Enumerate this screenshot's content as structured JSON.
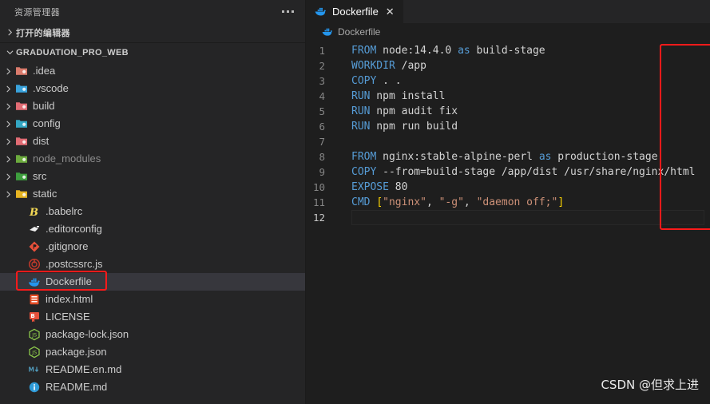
{
  "sidebar": {
    "header_title": "资源管理器",
    "more_actions": "more-actions",
    "open_editors_label": "打开的编辑器",
    "project_label": "GRADUATION_PRO_WEB",
    "items": [
      {
        "label": ".idea",
        "type": "folder",
        "icon": "folder-idea-icon",
        "color": "#d97b6c",
        "expandable": true,
        "dim": false,
        "indent": 18
      },
      {
        "label": ".vscode",
        "type": "folder",
        "icon": "folder-vscode-icon",
        "color": "#3aa3dc",
        "expandable": true,
        "dim": false,
        "indent": 18
      },
      {
        "label": "build",
        "type": "folder",
        "icon": "folder-build-icon",
        "color": "#e06c75",
        "expandable": true,
        "dim": false,
        "indent": 18
      },
      {
        "label": "config",
        "type": "folder",
        "icon": "folder-config-icon",
        "color": "#35a7c4",
        "expandable": true,
        "dim": false,
        "indent": 18
      },
      {
        "label": "dist",
        "type": "folder",
        "icon": "folder-dist-icon",
        "color": "#e06c75",
        "expandable": true,
        "dim": false,
        "indent": 18
      },
      {
        "label": "node_modules",
        "type": "folder",
        "icon": "folder-node-icon",
        "color": "#6cab3f",
        "expandable": true,
        "dim": true,
        "indent": 18
      },
      {
        "label": "src",
        "type": "folder",
        "icon": "folder-src-icon",
        "color": "#3f9e3f",
        "expandable": true,
        "dim": false,
        "indent": 18
      },
      {
        "label": "static",
        "type": "folder",
        "icon": "folder-static-icon",
        "color": "#e6b422",
        "expandable": true,
        "dim": false,
        "indent": 18
      },
      {
        "label": ".babelrc",
        "type": "file",
        "icon": "babel-icon",
        "color": "#f5da55",
        "expandable": false,
        "dim": false,
        "indent": 34
      },
      {
        "label": ".editorconfig",
        "type": "file",
        "icon": "editorconfig-icon",
        "color": "#eeeeee",
        "expandable": false,
        "dim": false,
        "indent": 34
      },
      {
        "label": ".gitignore",
        "type": "file",
        "icon": "git-icon",
        "color": "#e8503a",
        "expandable": false,
        "dim": false,
        "indent": 34
      },
      {
        "label": ".postcssrc.js",
        "type": "file",
        "icon": "postcss-icon",
        "color": "#c0392b",
        "expandable": false,
        "dim": false,
        "indent": 34
      },
      {
        "label": "Dockerfile",
        "type": "file",
        "icon": "docker-icon",
        "color": "#2496ed",
        "expandable": false,
        "dim": false,
        "indent": 34,
        "selected": true
      },
      {
        "label": "index.html",
        "type": "file",
        "icon": "html-icon",
        "color": "#e44d26",
        "expandable": false,
        "dim": false,
        "indent": 34
      },
      {
        "label": "LICENSE",
        "type": "file",
        "icon": "license-icon",
        "color": "#e8503a",
        "expandable": false,
        "dim": false,
        "indent": 34
      },
      {
        "label": "package-lock.json",
        "type": "file",
        "icon": "npm-json-icon",
        "color": "#8cc84b",
        "expandable": false,
        "dim": false,
        "indent": 34
      },
      {
        "label": "package.json",
        "type": "file",
        "icon": "npm-json-icon",
        "color": "#8cc84b",
        "expandable": false,
        "dim": false,
        "indent": 34
      },
      {
        "label": "README.en.md",
        "type": "file",
        "icon": "markdown-icon",
        "color": "#519aba",
        "expandable": false,
        "dim": false,
        "indent": 34
      },
      {
        "label": "README.md",
        "type": "file",
        "icon": "info-markdown-icon",
        "color": "#2f9bd8",
        "expandable": false,
        "dim": false,
        "indent": 34
      }
    ]
  },
  "editor": {
    "tab": {
      "label": "Dockerfile",
      "icon": "docker-icon",
      "close_glyph": "✕"
    },
    "breadcrumb": {
      "label": "Dockerfile",
      "icon": "docker-icon"
    },
    "active_line": 12,
    "lines": [
      {
        "n": 1,
        "tokens": [
          {
            "t": "FROM",
            "c": "kw"
          },
          {
            "t": " node:14.4.0 ",
            "c": ""
          },
          {
            "t": "as",
            "c": "kw"
          },
          {
            "t": " build-stage",
            "c": ""
          }
        ]
      },
      {
        "n": 2,
        "tokens": [
          {
            "t": "WORKDIR",
            "c": "kw"
          },
          {
            "t": " /app",
            "c": ""
          }
        ]
      },
      {
        "n": 3,
        "tokens": [
          {
            "t": "COPY",
            "c": "kw"
          },
          {
            "t": " . .",
            "c": ""
          }
        ]
      },
      {
        "n": 4,
        "tokens": [
          {
            "t": "RUN",
            "c": "kw"
          },
          {
            "t": " npm install",
            "c": ""
          }
        ]
      },
      {
        "n": 5,
        "tokens": [
          {
            "t": "RUN",
            "c": "kw"
          },
          {
            "t": " npm audit fix",
            "c": ""
          }
        ]
      },
      {
        "n": 6,
        "tokens": [
          {
            "t": "RUN",
            "c": "kw"
          },
          {
            "t": " npm run build",
            "c": ""
          }
        ]
      },
      {
        "n": 7,
        "tokens": []
      },
      {
        "n": 8,
        "tokens": [
          {
            "t": "FROM",
            "c": "kw"
          },
          {
            "t": " nginx:stable-alpine-perl ",
            "c": ""
          },
          {
            "t": "as",
            "c": "kw"
          },
          {
            "t": " production-stage",
            "c": ""
          }
        ]
      },
      {
        "n": 9,
        "tokens": [
          {
            "t": "COPY",
            "c": "kw"
          },
          {
            "t": " --from=build-stage /app/dist /usr/share/nginx/html",
            "c": ""
          }
        ]
      },
      {
        "n": 10,
        "tokens": [
          {
            "t": "EXPOSE",
            "c": "kw"
          },
          {
            "t": " 80",
            "c": ""
          }
        ]
      },
      {
        "n": 11,
        "tokens": [
          {
            "t": "CMD",
            "c": "kw"
          },
          {
            "t": " ",
            "c": ""
          },
          {
            "t": "[",
            "c": "brk"
          },
          {
            "t": "\"nginx\"",
            "c": "str"
          },
          {
            "t": ", ",
            "c": ""
          },
          {
            "t": "\"-g\"",
            "c": "str"
          },
          {
            "t": ", ",
            "c": ""
          },
          {
            "t": "\"daemon off;\"",
            "c": "str"
          },
          {
            "t": "]",
            "c": "brk"
          }
        ]
      },
      {
        "n": 12,
        "tokens": []
      }
    ]
  },
  "annotations": {
    "accent_color": "#ff1a1a",
    "sidebar_target": "Dockerfile",
    "code_target": "dockerfile-contents"
  },
  "watermark": {
    "text": "CSDN @但求上进"
  }
}
